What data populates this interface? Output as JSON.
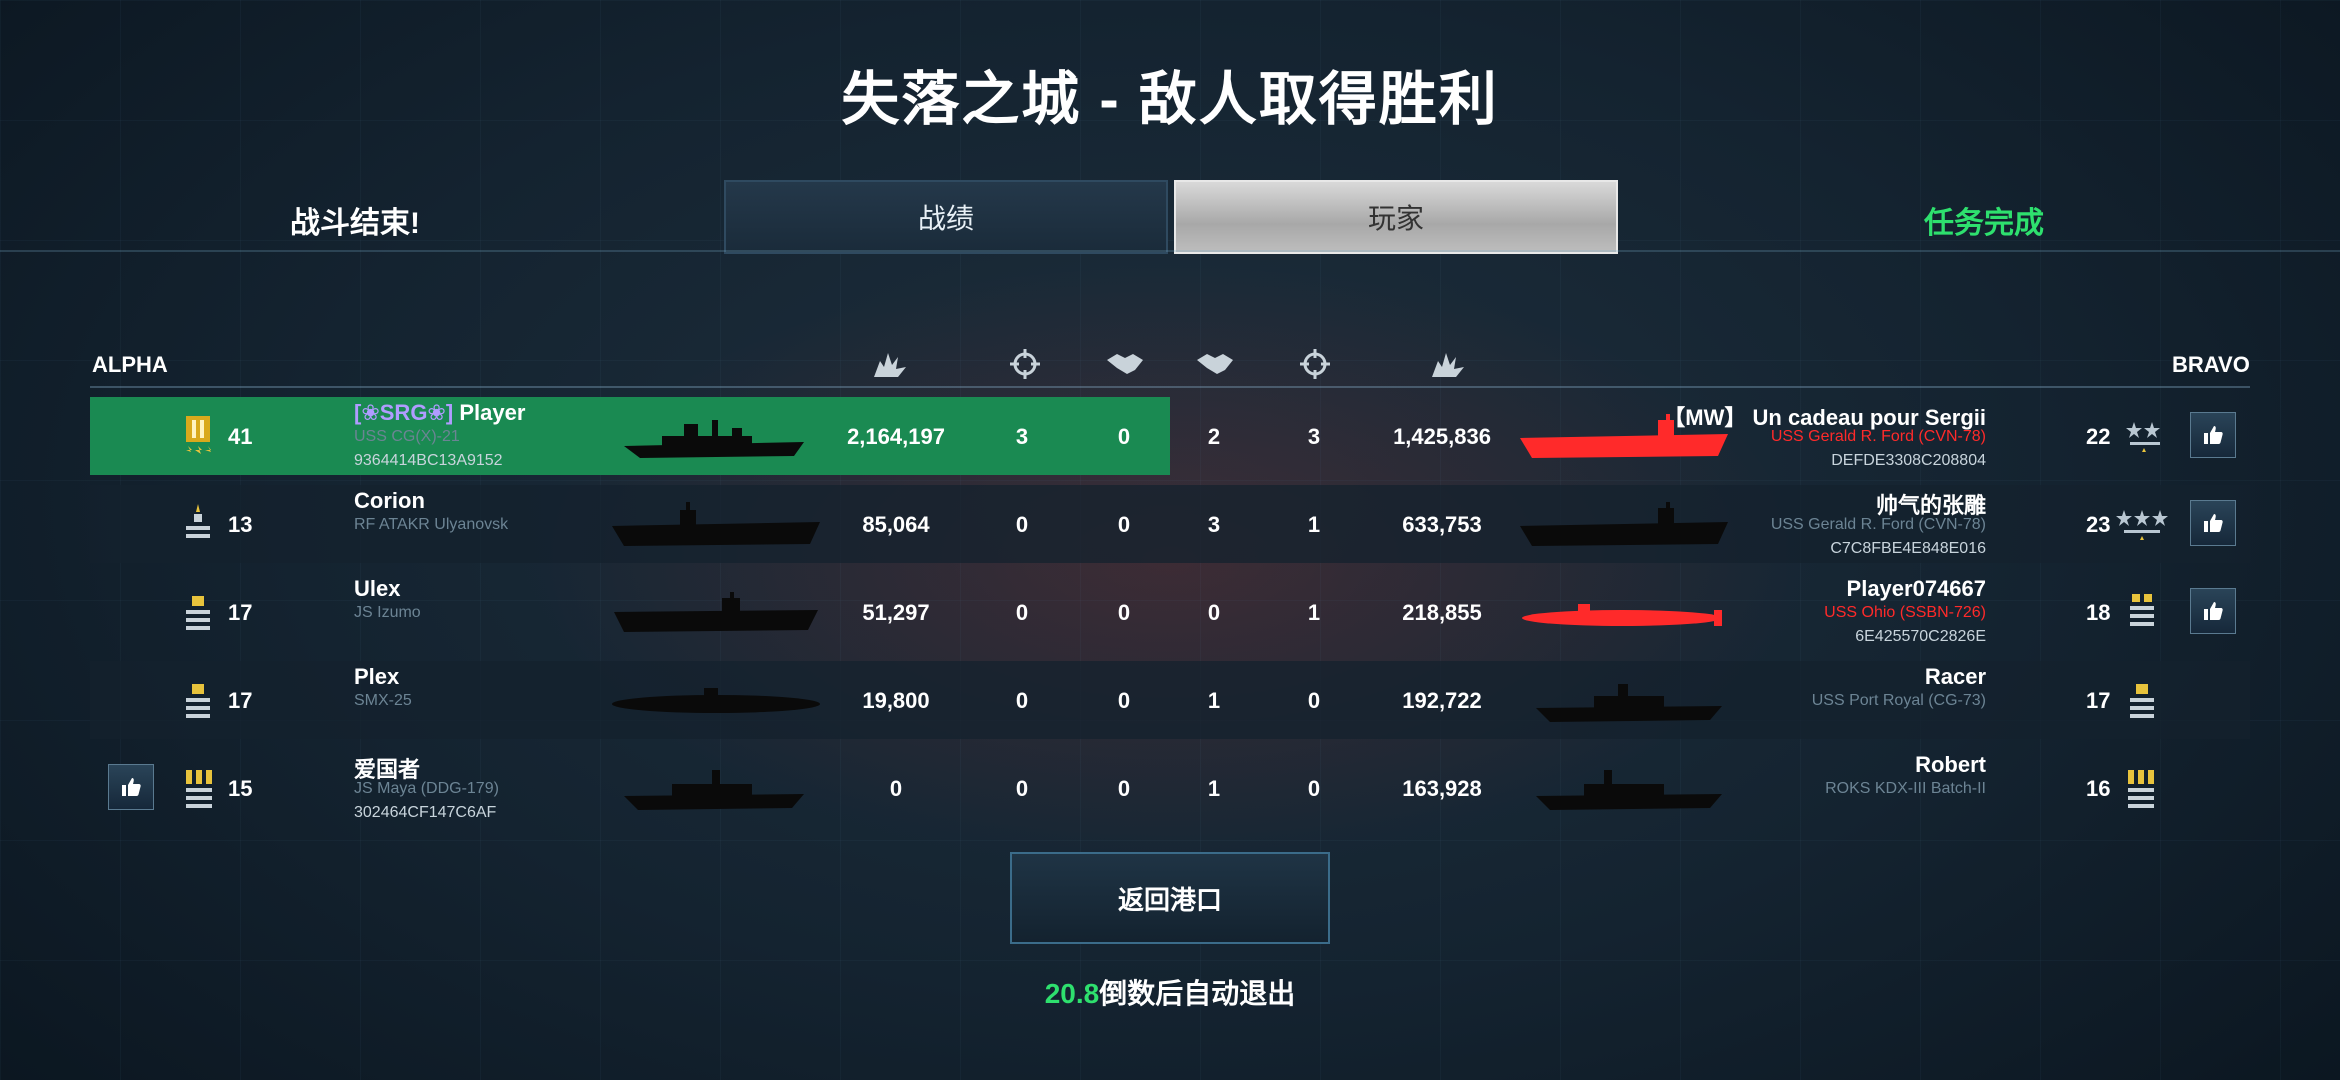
{
  "title": "失落之城 - 敌人取得胜利",
  "header": {
    "battle_over": "战斗结束!",
    "tab_stats": "战绩",
    "tab_players": "玩家",
    "mission_status": "任务完成"
  },
  "teams": {
    "alpha": "ALPHA",
    "bravo": "BRAVO"
  },
  "colors": {
    "highlight": "#1a8a52",
    "enemy_ship": "#ff2a2a",
    "green_text": "#2ee06e"
  },
  "rows": [
    {
      "left": {
        "rank_icon": "gold-rank-icon",
        "level": "41",
        "clan": "[❀SRG❀]",
        "name": "Player",
        "ship": "USS CG(X)-21",
        "id": "9364414BC13A9152",
        "score": "2,164,197",
        "kills": "3",
        "assists": "0"
      },
      "right": {
        "assists": "2",
        "kills": "3",
        "score": "1,425,836",
        "name": "【MW】 Un cadeau pour Sergii",
        "ship": "USS Gerald R. Ford (CVN-78)",
        "id": "DEFDE3308C208804",
        "level": "22",
        "rank_icon": "two-star-rank-icon"
      }
    },
    {
      "left": {
        "rank_icon": "silver-rank-icon",
        "level": "13",
        "name": "Corion",
        "ship": "RF ATAKR Ulyanovsk",
        "id": "",
        "score": "85,064",
        "kills": "0",
        "assists": "0"
      },
      "right": {
        "assists": "3",
        "kills": "1",
        "score": "633,753",
        "name": "帅气的张雕",
        "ship": "USS Gerald R. Ford (CVN-78)",
        "id": "C7C8FBE4E848E016",
        "level": "23",
        "rank_icon": "three-star-rank-icon"
      }
    },
    {
      "left": {
        "rank_icon": "silver-rank-icon",
        "level": "17",
        "name": "Ulex",
        "ship": "JS Izumo",
        "id": "",
        "score": "51,297",
        "kills": "0",
        "assists": "0"
      },
      "right": {
        "assists": "0",
        "kills": "1",
        "score": "218,855",
        "name": "Player074667",
        "ship": "USS Ohio (SSBN-726)",
        "id": "6E425570C2826E",
        "level": "18",
        "rank_icon": "silver-rank-icon"
      }
    },
    {
      "left": {
        "rank_icon": "silver-rank-icon",
        "level": "17",
        "name": "Plex",
        "ship": "SMX-25",
        "id": "",
        "score": "19,800",
        "kills": "0",
        "assists": "0"
      },
      "right": {
        "assists": "1",
        "kills": "0",
        "score": "192,722",
        "name": "Racer",
        "ship": "USS Port Royal (CG-73)",
        "id": "",
        "level": "17",
        "rank_icon": "silver-rank-icon"
      }
    },
    {
      "left": {
        "rank_icon": "gold-rank-icon",
        "level": "15",
        "name": "爱国者",
        "ship": "JS Maya (DDG-179)",
        "id": "302464CF147C6AF",
        "score": "0",
        "kills": "0",
        "assists": "0"
      },
      "right": {
        "assists": "1",
        "kills": "0",
        "score": "163,928",
        "name": "Robert",
        "ship": "ROKS KDX-III Batch-II",
        "id": "",
        "level": "16",
        "rank_icon": "gold-rank-icon"
      }
    }
  ],
  "footer": {
    "return_button": "返回港口",
    "countdown_seconds": "20.8",
    "countdown_text": "倒数后自动退出"
  }
}
